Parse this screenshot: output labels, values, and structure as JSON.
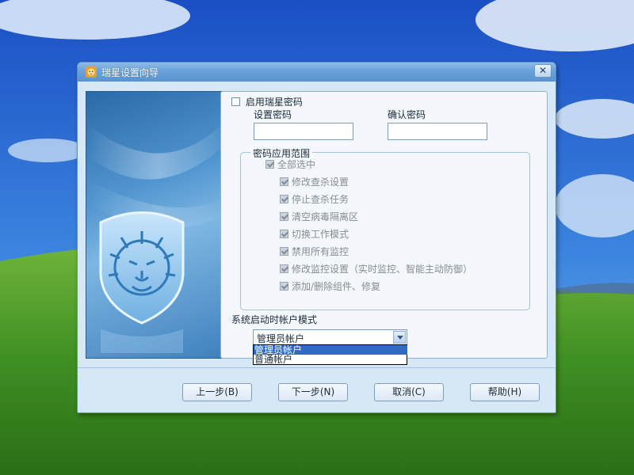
{
  "window": {
    "title": "瑞星设置向导",
    "close_glyph": "✕"
  },
  "password": {
    "enable_label": "启用瑞星密码",
    "enable_checked": false,
    "set_label": "设置密码",
    "set_value": "",
    "confirm_label": "确认密码",
    "confirm_value": ""
  },
  "scope": {
    "legend": "密码应用范围",
    "select_all_label": "全部选中",
    "items": [
      {
        "label": "修改查杀设置",
        "checked": true
      },
      {
        "label": "停止查杀任务",
        "checked": true
      },
      {
        "label": "清空病毒隔离区",
        "checked": true
      },
      {
        "label": "切换工作模式",
        "checked": true
      },
      {
        "label": "禁用所有监控",
        "checked": true
      },
      {
        "label": "修改监控设置（实时监控、智能主动防御）",
        "checked": true
      },
      {
        "label": "添加/删除组件、修复",
        "checked": true
      }
    ]
  },
  "startup": {
    "label": "系统启动时帐户模式",
    "selected": "管理员帐户",
    "options": [
      "管理员帐户",
      "普通帐户"
    ]
  },
  "buttons": {
    "prev": "上一步(B)",
    "next": "下一步(N)",
    "cancel": "取消(C)",
    "help": "帮助(H)"
  }
}
